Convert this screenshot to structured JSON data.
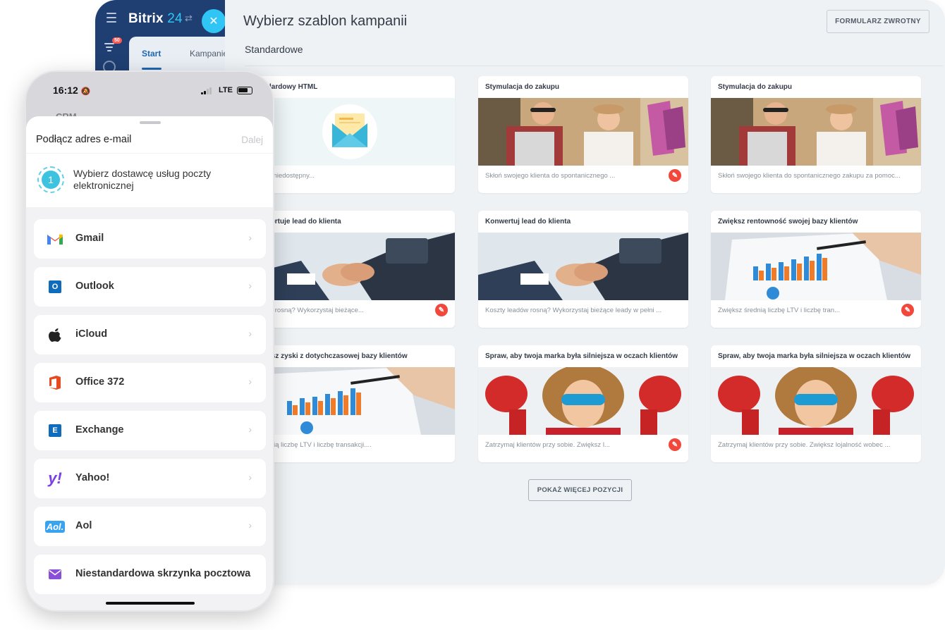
{
  "desktop": {
    "app_name": "Bitrix",
    "app_number": "24",
    "notification_count": "50",
    "tabs": [
      "Start",
      "Kampanie"
    ],
    "page_title": "Wybierz szablon kampanii",
    "feedback_button": "FORMULARZ ZWROTNY",
    "section_title": "Standardowe",
    "more_button": "POKAŻ WIĘCEJ POZYCJI",
    "cards": [
      {
        "title": "Standardowy HTML",
        "desc": "będzie niedostępny...",
        "image": "email-envelope-icon",
        "brush": false
      },
      {
        "title": "Stymulacja do zakupu",
        "desc": "Skłoń swojego klienta do spontanicznego ...",
        "image": "shopping-photo",
        "brush": true
      },
      {
        "title": "Stymulacja do zakupu",
        "desc": "Skłoń swojego klienta do spontanicznego zakupu za pomoc...",
        "image": "shopping-photo",
        "brush": false
      },
      {
        "title": "Konwertuje lead do klienta",
        "desc": "leadów rosną? Wykorzystaj bieżące...",
        "image": "handshake-photo",
        "brush": true
      },
      {
        "title": "Konwertuj lead do klienta",
        "desc": "Koszty leadów rosną? Wykorzystaj bieżące leady w pełni ...",
        "image": "handshake-photo",
        "brush": false
      },
      {
        "title": "Zwiększ rentowność swojej bazy klientów",
        "desc": "Zwiększ średnią liczbę LTV i liczbę tran...",
        "image": "chart-photo",
        "brush": true
      },
      {
        "title": "Zwiększ zyski z dotychczasowej bazy klientów",
        "desc": "z średnią liczbę LTV i liczbę transakcji....",
        "image": "chart-photo",
        "brush": false
      },
      {
        "title": "Spraw, aby twoja marka była silniejsza w oczach klientów",
        "desc": "Zatrzymaj klientów przy sobie. Zwiększ l...",
        "image": "superhero-kid-photo",
        "brush": true
      },
      {
        "title": "Spraw, aby twoja marka była silniejsza w oczach klientów",
        "desc": "Zatrzymaj klientów przy sobie. Zwiększ lojalność wobec ...",
        "image": "superhero-kid-photo",
        "brush": false
      }
    ]
  },
  "phone": {
    "time": "16:12",
    "network": "LTE",
    "peek_text": "CRM",
    "sheet_title": "Podłącz adres e-mail",
    "next_button": "Dalej",
    "step_number": "1",
    "step_text": "Wybierz dostawcę usług poczty elektronicznej",
    "progress": "1 of 3",
    "providers": [
      {
        "name": "Gmail",
        "icon": "gmail-icon"
      },
      {
        "name": "Outlook",
        "icon": "outlook-icon"
      },
      {
        "name": "iCloud",
        "icon": "apple-icon"
      },
      {
        "name": "Office 372",
        "icon": "office-icon"
      },
      {
        "name": "Exchange",
        "icon": "exchange-icon"
      },
      {
        "name": "Yahoo!",
        "icon": "yahoo-icon"
      },
      {
        "name": "Aol",
        "icon": "aol-icon"
      },
      {
        "name": "Niestandardowa skrzynka pocztowa",
        "icon": "mailbox-icon"
      }
    ],
    "colors": {
      "accent": "#3dc3e0",
      "brand_blue": "#2fc6f6",
      "header": "#1f3e72",
      "brush": "#f2473b"
    }
  }
}
